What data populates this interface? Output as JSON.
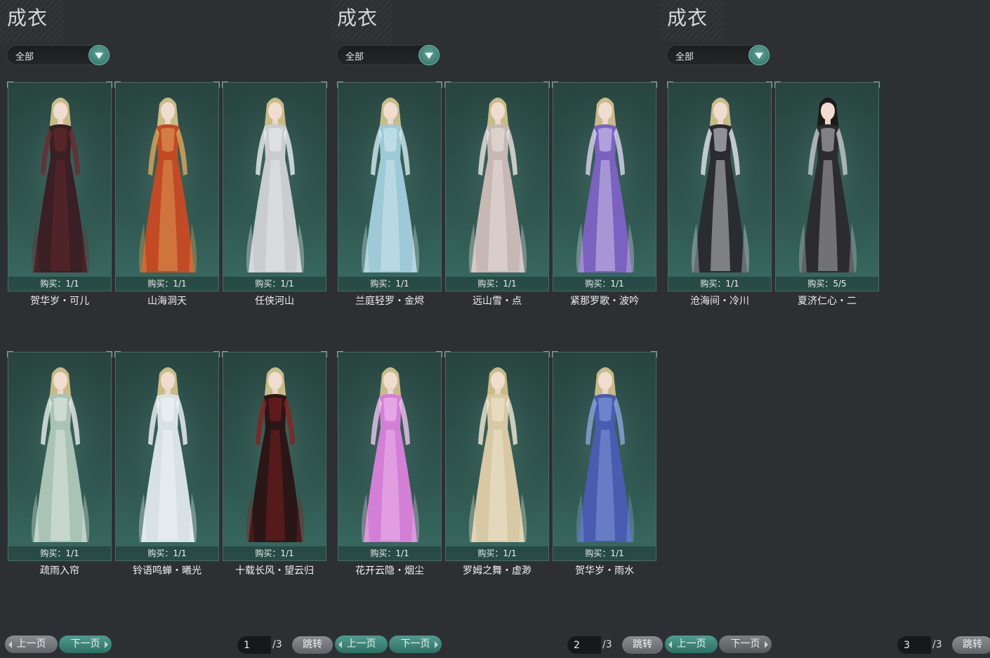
{
  "panels": [
    {
      "title": "成衣",
      "filter": "全部",
      "prev": "上一页",
      "next": "下一页",
      "page": "1",
      "total": "/3",
      "jump": "跳转",
      "active_button": "next",
      "items": [
        {
          "buy": "购买：1/1",
          "name": "贺华岁・可儿",
          "outfit": "#3a1f24",
          "accent": "#6b2a30",
          "hair": "#d8c88f"
        },
        {
          "buy": "购买：1/1",
          "name": "山海洞天",
          "outfit": "#c24a24",
          "accent": "#e0a85a",
          "hair": "#d8c88f"
        },
        {
          "buy": "购买：1/1",
          "name": "任侠河山",
          "outfit": "#c9cdd0",
          "accent": "#eef0f2",
          "hair": "#d8c88f"
        },
        {
          "buy": "购买：1/1",
          "name": "疏雨入帘",
          "outfit": "#a9c4b4",
          "accent": "#eaf0ec",
          "hair": "#d8c88f"
        },
        {
          "buy": "购买：1/1",
          "name": "铃语鸣蝉・曦光",
          "outfit": "#d8e2e6",
          "accent": "#f4f6f8",
          "hair": "#d8c88f"
        },
        {
          "buy": "购买：1/1",
          "name": "十载长风・望云归",
          "outfit": "#2a1616",
          "accent": "#8a2020",
          "hair": "#d8c88f"
        }
      ]
    },
    {
      "title": "成衣",
      "filter": "全部",
      "prev": "上一页",
      "next": "下一页",
      "page": "2",
      "total": "/3",
      "jump": "跳转",
      "active_button": "both",
      "items": [
        {
          "buy": "购买：1/1",
          "name": "兰庭轻罗・金烬",
          "outfit": "#9ec9d6",
          "accent": "#d6ecf2",
          "hair": "#d8c88f"
        },
        {
          "buy": "购买：1/1",
          "name": "远山雪・点",
          "outfit": "#c8b8b4",
          "accent": "#ede6e2",
          "hair": "#d8c88f"
        },
        {
          "buy": "购买：1/1",
          "name": "紧那罗歌・波吟",
          "outfit": "#7b62c0",
          "accent": "#dcd6ef",
          "hair": "#d8c88f"
        },
        {
          "buy": "购买：1/1",
          "name": "花开云隐・烟尘",
          "outfit": "#d47fd6",
          "accent": "#f0c6f0",
          "hair": "#d8c88f"
        },
        {
          "buy": "购买：1/1",
          "name": "罗姆之舞・虚渺",
          "outfit": "#d8c8a4",
          "accent": "#f2ead6",
          "hair": "#d8c88f"
        },
        {
          "buy": "购买：1/1",
          "name": "贺华岁・雨水",
          "outfit": "#4a5cb0",
          "accent": "#8aa6e0",
          "hair": "#d8c88f"
        }
      ]
    },
    {
      "title": "成衣",
      "filter": "全部",
      "prev": "上一页",
      "next": "下一页",
      "page": "3",
      "total": "/3",
      "jump": "跳转",
      "active_button": "prev",
      "items": [
        {
          "buy": "购买：1/1",
          "name": "沧海间・冷川",
          "outfit": "#2a2c30",
          "accent": "#e4e6ec",
          "hair": "#d8c88f"
        },
        {
          "buy": "购买：5/5",
          "name": "夏济仁心・二",
          "outfit": "#2c2c2e",
          "accent": "#c8c8cc",
          "hair": "#1a1414"
        }
      ]
    }
  ]
}
